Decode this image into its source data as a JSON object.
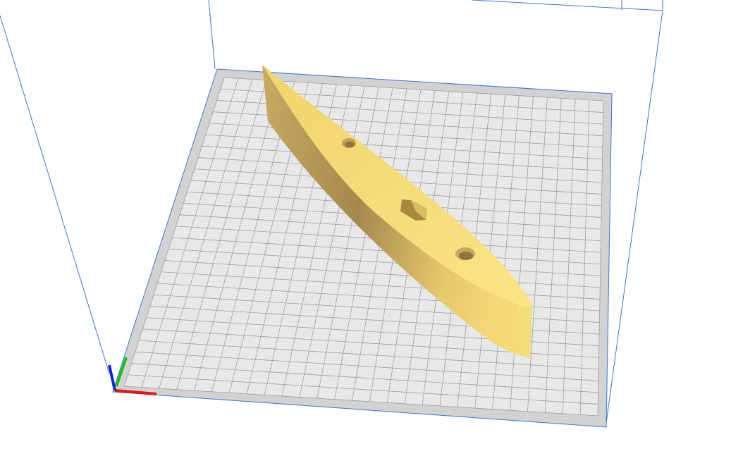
{
  "viewport": {
    "background": "#ffffff",
    "plate_color": "#e8e8e8",
    "plate_border_color": "#d2d2d2",
    "grid_color": "#9aa0a8",
    "build_volume_line_color": "#3a78d0",
    "model_color": "#f3d76c"
  },
  "axes": {
    "x_color": "#e01818",
    "y_color": "#18c018",
    "z_color": "#1820e0"
  },
  "model": {
    "features": [
      "hole-icon",
      "hex-slot-icon",
      "hole-icon"
    ]
  }
}
